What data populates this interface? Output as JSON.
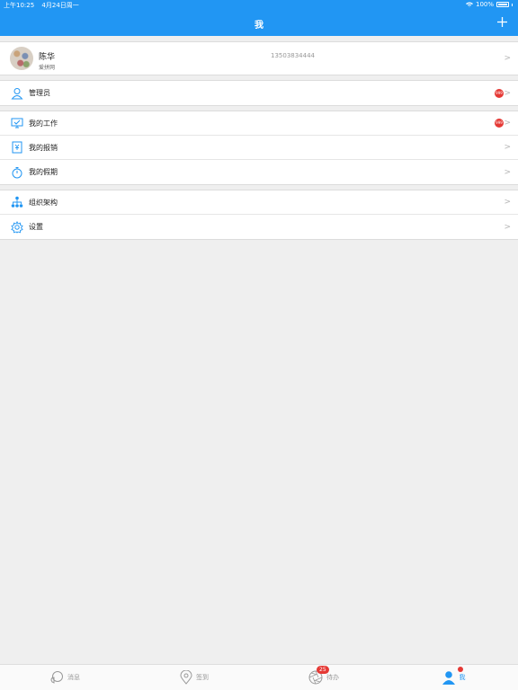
{
  "status_bar": {
    "time": "上午10:25",
    "date": "4月24日周一",
    "battery": "100%"
  },
  "nav": {
    "title": "我",
    "add_icon": "plus-icon"
  },
  "profile": {
    "name": "陈华",
    "company": "爱拼网",
    "phone": "13503834444"
  },
  "menu": {
    "admin": {
      "label": "管理员",
      "badge": "999"
    },
    "work": {
      "label": "我的工作",
      "badge": "999"
    },
    "reimburse": {
      "label": "我的报销"
    },
    "leave": {
      "label": "我的假期"
    },
    "org": {
      "label": "组织架构"
    },
    "settings": {
      "label": "设置"
    }
  },
  "tabs": {
    "messages": {
      "label": "消息"
    },
    "checkin": {
      "label": "签到"
    },
    "todo": {
      "label": "待办",
      "badge": "25"
    },
    "me": {
      "label": "我"
    }
  },
  "colors": {
    "accent": "#2196f3",
    "badge": "#e53935"
  }
}
